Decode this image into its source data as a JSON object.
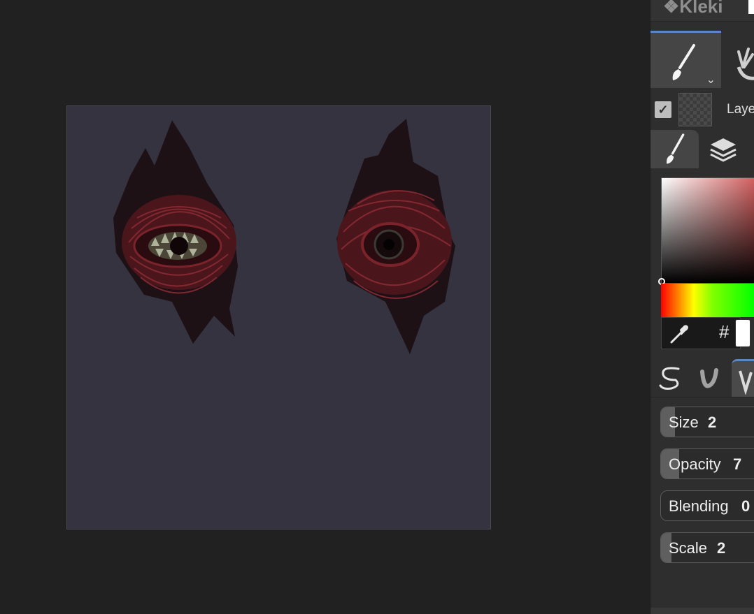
{
  "app": {
    "logo_text": "Kleki"
  },
  "toolbar": {
    "brush_tool": {
      "icon": "brush-icon",
      "dropdown_icon": "chevron-down-icon"
    },
    "hand_tool": {
      "icon": "hand-icon"
    }
  },
  "layer": {
    "visible_icon": "checkbox-checked-icon",
    "name": "Laye"
  },
  "tabs": [
    {
      "icon": "brush-icon",
      "active": true
    },
    {
      "icon": "layers-icon",
      "active": false
    }
  ],
  "color_picker": {
    "hex_symbol": "#",
    "eyedropper_icon": "eyedropper-icon",
    "current_color": "#ffffff",
    "hue_color": "#d36060"
  },
  "brush_tabs": [
    {
      "icon": "pen-brush-icon",
      "active": false
    },
    {
      "icon": "blend-brush-icon",
      "active": false
    },
    {
      "icon": "sketchy-brush-icon",
      "active": true
    }
  ],
  "sliders": [
    {
      "label": "Size",
      "value": "2"
    },
    {
      "label": "Opacity",
      "value": "7"
    },
    {
      "label": "Blending",
      "value": "0"
    },
    {
      "label": "Scale",
      "value": "2"
    }
  ],
  "canvas": {
    "background_color": "#34333f"
  }
}
